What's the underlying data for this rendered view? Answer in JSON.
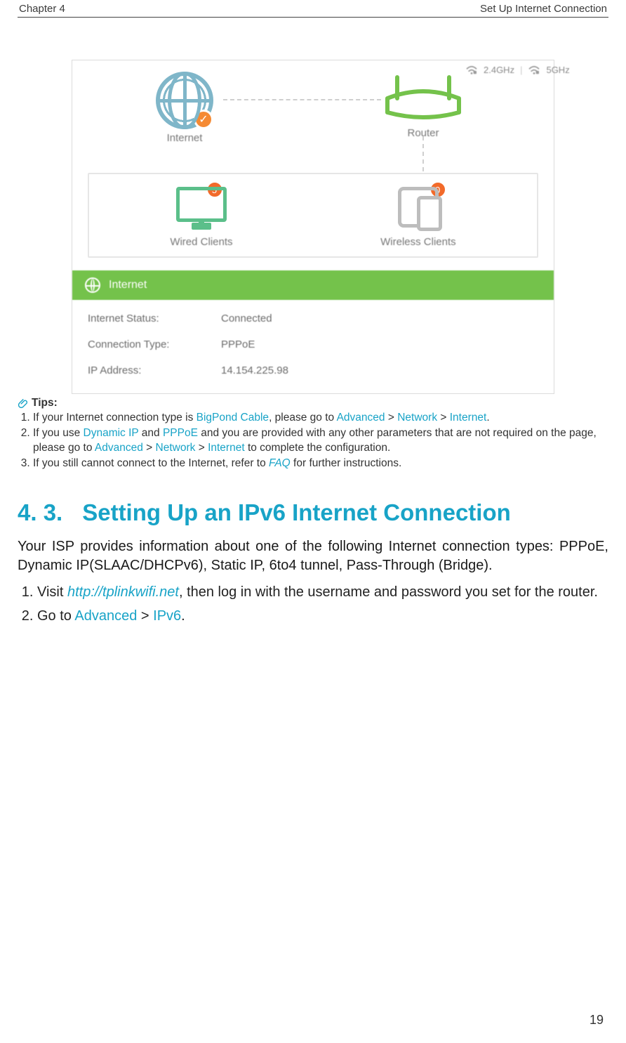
{
  "header": {
    "left": "Chapter 4",
    "right": "Set Up Internet Connection"
  },
  "figure": {
    "internet_label": "Internet",
    "router_label": "Router",
    "wifi_band_1": "2.4GHz",
    "wifi_band_2": "5GHz",
    "wired_clients_label": "Wired Clients",
    "wireless_clients_label": "Wireless Clients",
    "wired_count": "5",
    "wireless_count": "0",
    "internet_strip": "Internet",
    "rows": [
      {
        "k": "Internet Status:",
        "v": "Connected"
      },
      {
        "k": "Connection Type:",
        "v": "PPPoE"
      },
      {
        "k": "IP Address:",
        "v": "14.154.225.98"
      }
    ]
  },
  "tips": {
    "label": "Tips:",
    "items": [
      {
        "pre": "If your Internet connection type is ",
        "l1": "BigPond Cable",
        "mid1": ", please go to ",
        "l2": "Advanced",
        "gt1": " > ",
        "l3": "Network",
        "gt2": " > ",
        "l4": "Internet",
        "post": "."
      },
      {
        "pre": "If you use ",
        "l1": "Dynamic IP",
        "mid1": " and ",
        "l2": "PPPoE",
        "mid2": " and you are provided with any other parameters that are not required on the page, please go to ",
        "l3": "Advanced",
        "gt1": " > ",
        "l4": "Network",
        "gt2": " > ",
        "l5": "Internet",
        "post": " to complete the configuration."
      },
      {
        "pre": "If you still cannot connect to the Internet, refer to ",
        "l1": "FAQ",
        "post": " for further instructions."
      }
    ]
  },
  "section": {
    "number": "4. 3.",
    "title": "Setting Up an IPv6 Internet Connection",
    "intro": "Your ISP provides information about one of the following Internet connection types: PPPoE, Dynamic IP(SLAAC/DHCPv6), Static IP, 6to4 tunnel,  Pass-Through (Bridge).",
    "steps": [
      {
        "pre": "Visit ",
        "link": "http://tplinkwifi.net",
        "post": ", then log in with the username and password you set for the router."
      },
      {
        "pre": "Go to ",
        "l1": "Advanced",
        "gt": " > ",
        "l2": "IPv6",
        "post": "."
      }
    ]
  },
  "page_number": "19"
}
